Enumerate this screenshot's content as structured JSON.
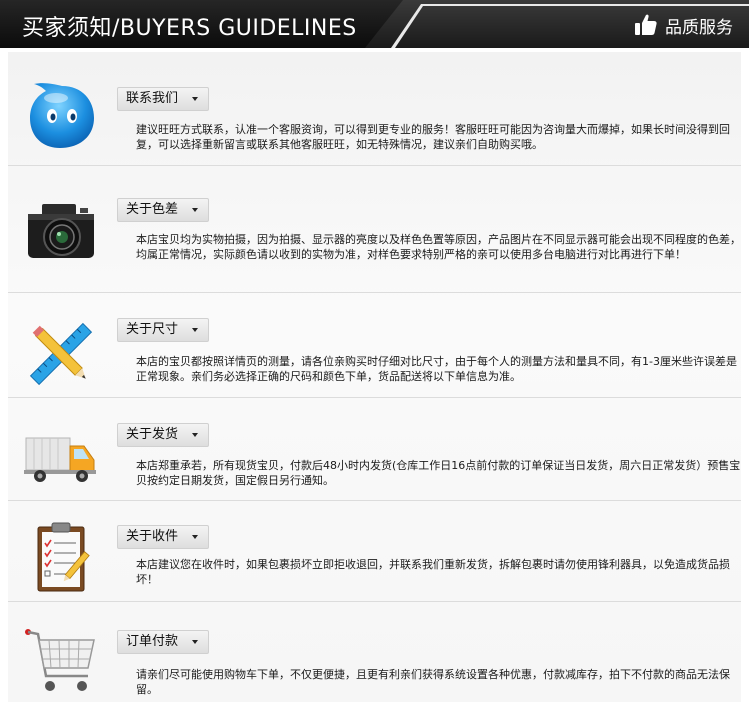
{
  "header": {
    "title": "买家须知/BUYERS GUIDELINES",
    "right_label": "品质服务",
    "right_icon": "thumbs-up-icon"
  },
  "sections": [
    {
      "icon": "wangwang-chat-icon",
      "label": "联系我们",
      "text": "建议旺旺方式联系，认准一个客服资询，可以得到更专业的服务！客服旺旺可能因为咨询量大而爆掉，如果长时间没得到回复，可以选择重新留言或联系其他客服旺旺，如无特殊情况，建议亲们自助购买哦。"
    },
    {
      "icon": "camera-icon",
      "label": "关于色差",
      "text": "本店宝贝均为实物拍摄，因为拍摄、显示器的亮度以及样色色置等原因，产品图片在不同显示器可能会出现不同程度的色差，均属正常情况，实际颜色请以收到的实物为准，对样色要求特别严格的亲可以使用多台电脑进行对比再进行下单！"
    },
    {
      "icon": "ruler-pencil-icon",
      "label": "关于尺寸",
      "text": "本店的宝贝都按照详情页的测量，请各位亲购买时仔细对比尺寸，由于每个人的测量方法和量具不同，有1-3厘米些许误差是正常现象。亲们务必选择正确的尺码和颜色下单，货品配送将以下单信息为准。"
    },
    {
      "icon": "delivery-truck-icon",
      "label": "关于发货",
      "text": "本店郑重承若，所有现货宝贝，付款后48小时内发货(仓库工作日16点前付款的订单保证当日发货，周六日正常发货）预售宝贝按约定日期发货，国定假日另行通知。"
    },
    {
      "icon": "clipboard-icon",
      "label": "关于收件",
      "text": "本店建议您在收件时，如果包裹损坏立即拒收退回，并联系我们重新发货，拆解包裹时请勿使用锋利器具，以免造成货品损坏！"
    },
    {
      "icon": "shopping-cart-icon",
      "label": "订单付款",
      "text": "请亲们尽可能使用购物车下单，不仅更便捷，且更有利亲们获得系统设置各种优惠，付款减库存，拍下不付款的商品无法保留。"
    }
  ]
}
